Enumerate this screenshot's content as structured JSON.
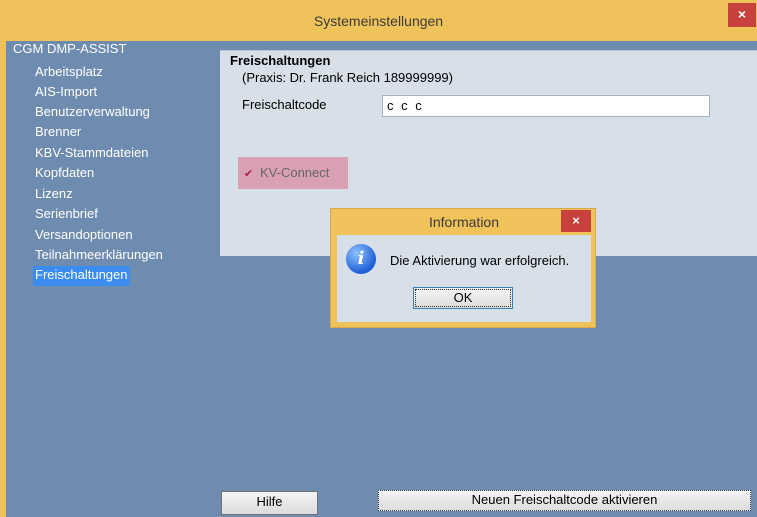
{
  "window": {
    "title": "Systemeinstellungen",
    "close_icon": "×"
  },
  "tree": {
    "root": "CGM DMP-ASSIST",
    "items": [
      "Arbeitsplatz",
      "AIS-Import",
      "Benutzerverwaltung",
      "Brenner",
      "KBV-Stammdateien",
      "Kopfdaten",
      "Lizenz",
      "Serienbrief",
      "Versandoptionen",
      "Teilnahmeerklärungen",
      "Freischaltungen"
    ],
    "selected": "Freischaltungen"
  },
  "panel": {
    "title": "Freischaltungen",
    "praxis": "(Praxis: Dr. Frank Reich 189999999)",
    "code_label": "Freischaltcode",
    "code_value": "c c c",
    "kv_check": "✔",
    "kv_label": "KV-Connect"
  },
  "buttons": {
    "help": "Hilfe",
    "activate": "Neuen Freischaltcode aktivieren"
  },
  "dialog": {
    "title": "Information",
    "close_icon": "×",
    "icon": "i",
    "message": "Die Aktivierung war erfolgreich.",
    "ok": "OK"
  }
}
